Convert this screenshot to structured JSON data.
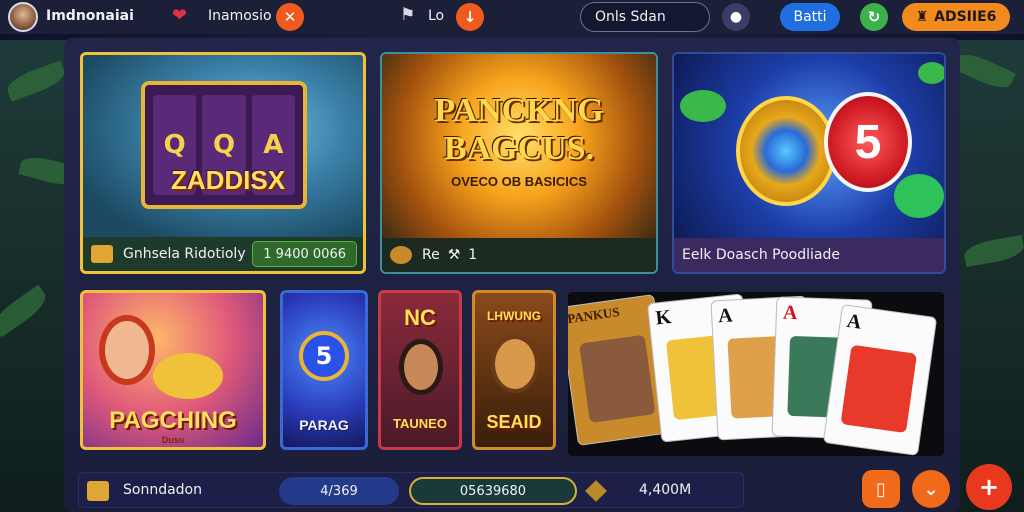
{
  "header": {
    "title": "Imdnonaiai",
    "promo_label": "Inamosio",
    "lo_label": "Lo",
    "search_text": "Onls Sdan",
    "batt_label": "Batti",
    "balance_label": "ADSIIE6"
  },
  "featured": [
    {
      "art_title": "ZADDISX",
      "reels": [
        "Q",
        "Q",
        "A"
      ],
      "label": "Gnhsela Ridotioly",
      "amount": "1 9400 0066"
    },
    {
      "art_title_line1": "PANCKNG",
      "art_title_line2": "BAGCUS.",
      "art_subtitle": "OVECO OB BASICICS",
      "label": "Re",
      "count": "1"
    },
    {
      "badge_number": "5",
      "label": "Eelk Doasch Poodliade"
    }
  ],
  "tiles": [
    {
      "title": "PAGCHING",
      "subtitle": "Dusu"
    },
    {
      "number": "5",
      "title": "PARAG"
    },
    {
      "top": "NC",
      "bottom": "TAUNEO"
    },
    {
      "top": "LHWUNG",
      "bottom": "SEAID"
    }
  ],
  "cards": {
    "first_title": "PANKUS",
    "ranks": [
      "K",
      "A",
      "A",
      "A"
    ]
  },
  "bottombar": {
    "label": "Sonndadon",
    "pill1": "4/369",
    "pill2": "05639680",
    "amount": "4,400M"
  }
}
